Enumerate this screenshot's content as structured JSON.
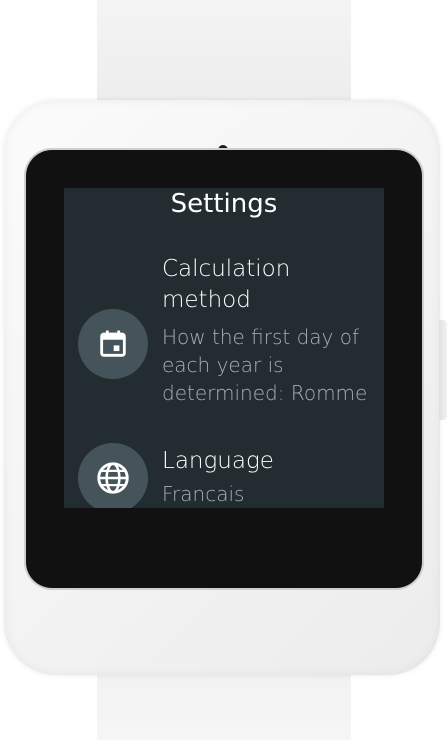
{
  "screen": {
    "title": "Settings"
  },
  "settings": {
    "items": [
      {
        "title": "Calculation method",
        "summary": "How the first day of each year is determined: Romme",
        "icon": "calendar-icon"
      },
      {
        "title": "Language",
        "summary": "Francais",
        "icon": "globe-icon"
      }
    ]
  },
  "colors": {
    "screen_background": "#232d31",
    "icon_circle": "#45535a",
    "summary_text": "#a7b0b4"
  }
}
